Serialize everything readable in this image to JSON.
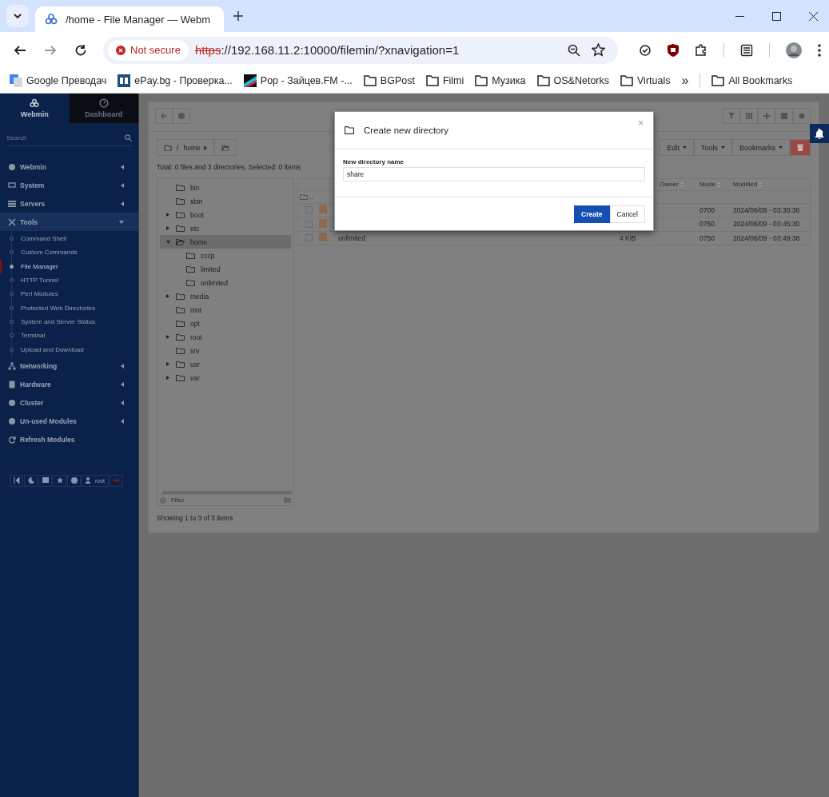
{
  "browser": {
    "tab": {
      "title": "/home - File Manager — Webm"
    },
    "address": {
      "security": "Not secure",
      "scheme": "https",
      "rest": "://192.168.11.2:10000/filemin/?xnavigation=1"
    },
    "bookmarks": [
      {
        "label": "Google Преводач",
        "kind": "google"
      },
      {
        "label": "ePay.bg - Проверка...",
        "kind": "epay"
      },
      {
        "label": "Pop - Зайцев.FM -...",
        "kind": "radio"
      },
      {
        "label": "BGPost",
        "kind": "folder"
      },
      {
        "label": "Filmi",
        "kind": "folder"
      },
      {
        "label": "Музика",
        "kind": "folder"
      },
      {
        "label": "OS&Netorks",
        "kind": "folder"
      },
      {
        "label": "Virtuals",
        "kind": "folder"
      }
    ],
    "overflow": "»",
    "all_bookmarks": "All Bookmarks"
  },
  "sidebar": {
    "tabs": [
      {
        "label": "Webmin",
        "selected": true
      },
      {
        "label": "Dashboard",
        "selected": false
      }
    ],
    "search": {
      "placeholder": "Search"
    },
    "menu": [
      {
        "label": "Webmin",
        "expanded": false
      },
      {
        "label": "System",
        "expanded": false
      },
      {
        "label": "Servers",
        "expanded": false
      },
      {
        "label": "Tools",
        "expanded": true,
        "children": [
          {
            "label": "Command Shell",
            "selected": false
          },
          {
            "label": "Custom Commands",
            "selected": false
          },
          {
            "label": "File Manager",
            "selected": true
          },
          {
            "label": "HTTP Tunnel",
            "selected": false
          },
          {
            "label": "Perl Modules",
            "selected": false
          },
          {
            "label": "Protected Web Directories",
            "selected": false
          },
          {
            "label": "System and Server Status",
            "selected": false
          },
          {
            "label": "Terminal",
            "selected": false
          },
          {
            "label": "Upload and Download",
            "selected": false
          }
        ]
      },
      {
        "label": "Networking",
        "expanded": false
      },
      {
        "label": "Hardware",
        "expanded": false
      },
      {
        "label": "Cluster",
        "expanded": false
      },
      {
        "label": "Un-used Modules",
        "expanded": false
      },
      {
        "label": "Refresh Modules"
      }
    ],
    "footer": {
      "user": "root"
    }
  },
  "file_manager": {
    "breadcrumb": {
      "folder": "home",
      "separator": "/"
    },
    "menus": [
      "Edit",
      "Tools",
      "Bookmarks"
    ],
    "summary": "Total: 0 files and 3 directories. Selected: 0 items",
    "tree": [
      {
        "name": "bin",
        "expandable": false,
        "expanded": false,
        "selected": false
      },
      {
        "name": "sbin",
        "expandable": false,
        "expanded": false,
        "selected": false
      },
      {
        "name": "boot",
        "expandable": true,
        "expanded": false,
        "selected": false
      },
      {
        "name": "etc",
        "expandable": true,
        "expanded": false,
        "selected": false
      },
      {
        "name": "home",
        "expandable": true,
        "expanded": true,
        "selected": true,
        "children": [
          {
            "name": "cccp",
            "expandable": false,
            "expanded": false,
            "selected": false
          },
          {
            "name": "limited",
            "expandable": false,
            "expanded": false,
            "selected": false
          },
          {
            "name": "unlimited",
            "expandable": false,
            "expanded": false,
            "selected": false
          }
        ]
      },
      {
        "name": "media",
        "expandable": true,
        "expanded": false,
        "selected": false
      },
      {
        "name": "mnt",
        "expandable": false,
        "expanded": false,
        "selected": false
      },
      {
        "name": "opt",
        "expandable": false,
        "expanded": false,
        "selected": false
      },
      {
        "name": "root",
        "expandable": true,
        "expanded": false,
        "selected": false
      },
      {
        "name": "srv",
        "expandable": false,
        "expanded": false,
        "selected": false
      },
      {
        "name": "usr",
        "expandable": true,
        "expanded": false,
        "selected": false
      },
      {
        "name": "var",
        "expandable": true,
        "expanded": false,
        "selected": false
      }
    ],
    "filter": {
      "placeholder": "Filter"
    },
    "table": {
      "columns": [
        "Owner",
        "Mode",
        "Modified"
      ],
      "parent": "..",
      "rows": [
        {
          "checked": false,
          "mode": "0700",
          "modified": "2024/06/09 - 03:30:36"
        },
        {
          "checked": false,
          "mode": "0750",
          "modified": "2024/06/09 - 03:45:30"
        },
        {
          "checked": false,
          "name": "unlimited",
          "size": "4 KiB",
          "mode": "0750",
          "modified": "2024/06/09 - 03:49:38"
        }
      ]
    },
    "footer": "Showing 1 to 3 of 3 items"
  },
  "dialog": {
    "title": "Create new directory",
    "close": "×",
    "label": "New directory name",
    "value": "share",
    "buttons": [
      {
        "label": "Create",
        "kind": "primary"
      },
      {
        "label": "Cancel",
        "kind": "default"
      }
    ]
  }
}
